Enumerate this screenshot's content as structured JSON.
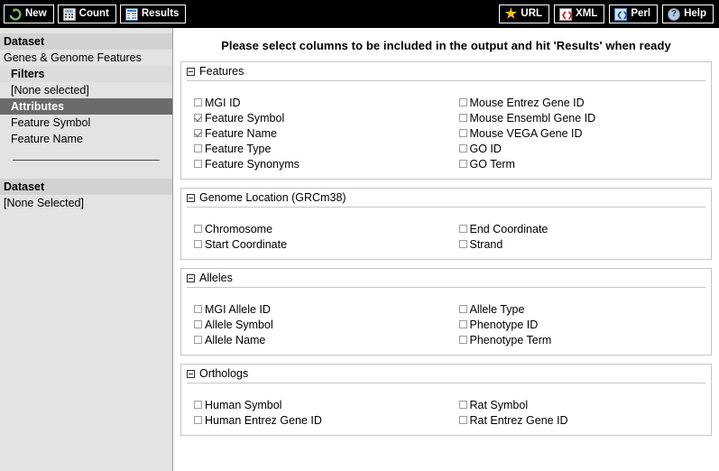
{
  "toolbar": {
    "left_buttons": [
      {
        "label": "New",
        "icon": "refresh-icon"
      },
      {
        "label": "Count",
        "icon": "calculator-icon"
      },
      {
        "label": "Results",
        "icon": "table-icon"
      }
    ],
    "right_buttons": [
      {
        "label": "URL",
        "icon": "star-icon"
      },
      {
        "label": "XML",
        "icon": "xml-document-icon"
      },
      {
        "label": "Perl",
        "icon": "perl-document-icon"
      },
      {
        "label": "Help",
        "icon": "question-circle-icon"
      }
    ]
  },
  "sidebar": {
    "dataset_label": "Dataset",
    "dataset_value": "Genes & Genome Features",
    "filters_label": "Filters",
    "filters_value": "[None selected]",
    "attributes_label": "Attributes",
    "attributes_items": [
      "Feature Symbol",
      "Feature Name"
    ],
    "dataset2_label": "Dataset",
    "dataset2_value": "[None Selected]"
  },
  "main": {
    "title": "Please select columns to be included in the output and hit 'Results' when ready",
    "sections": [
      {
        "title": "Features",
        "left": [
          {
            "label": "MGI ID",
            "checked": false
          },
          {
            "label": "Feature Symbol",
            "checked": true
          },
          {
            "label": "Feature Name",
            "checked": true
          },
          {
            "label": "Feature Type",
            "checked": false
          },
          {
            "label": "Feature Synonyms",
            "checked": false
          }
        ],
        "right": [
          {
            "label": "Mouse Entrez Gene ID",
            "checked": false
          },
          {
            "label": "Mouse Ensembl Gene ID",
            "checked": false
          },
          {
            "label": "Mouse VEGA Gene ID",
            "checked": false
          },
          {
            "label": "GO ID",
            "checked": false
          },
          {
            "label": "GO Term",
            "checked": false
          }
        ]
      },
      {
        "title": "Genome Location (GRCm38)",
        "left": [
          {
            "label": "Chromosome",
            "checked": false
          },
          {
            "label": "Start Coordinate",
            "checked": false
          }
        ],
        "right": [
          {
            "label": "End Coordinate",
            "checked": false
          },
          {
            "label": "Strand",
            "checked": false
          }
        ]
      },
      {
        "title": "Alleles",
        "left": [
          {
            "label": "MGI Allele ID",
            "checked": false
          },
          {
            "label": "Allele Symbol",
            "checked": false
          },
          {
            "label": "Allele Name",
            "checked": false
          }
        ],
        "right": [
          {
            "label": "Allele Type",
            "checked": false
          },
          {
            "label": "Phenotype ID",
            "checked": false
          },
          {
            "label": "Phenotype Term",
            "checked": false
          }
        ]
      },
      {
        "title": "Orthologs",
        "left": [
          {
            "label": "Human Symbol",
            "checked": false
          },
          {
            "label": "Human Entrez Gene ID",
            "checked": false
          }
        ],
        "right": [
          {
            "label": "Rat Symbol",
            "checked": false
          },
          {
            "label": "Rat Entrez Gene ID",
            "checked": false
          }
        ]
      }
    ]
  },
  "colors": {
    "toolbar_bg": "#000000",
    "sidebar_bg": "#e3e3e3",
    "selected_row_bg": "#6b6b6b",
    "panel_border": "#c6c6c6",
    "new_icon_green": "#79b55c",
    "star_yellow": "#f2c025"
  }
}
